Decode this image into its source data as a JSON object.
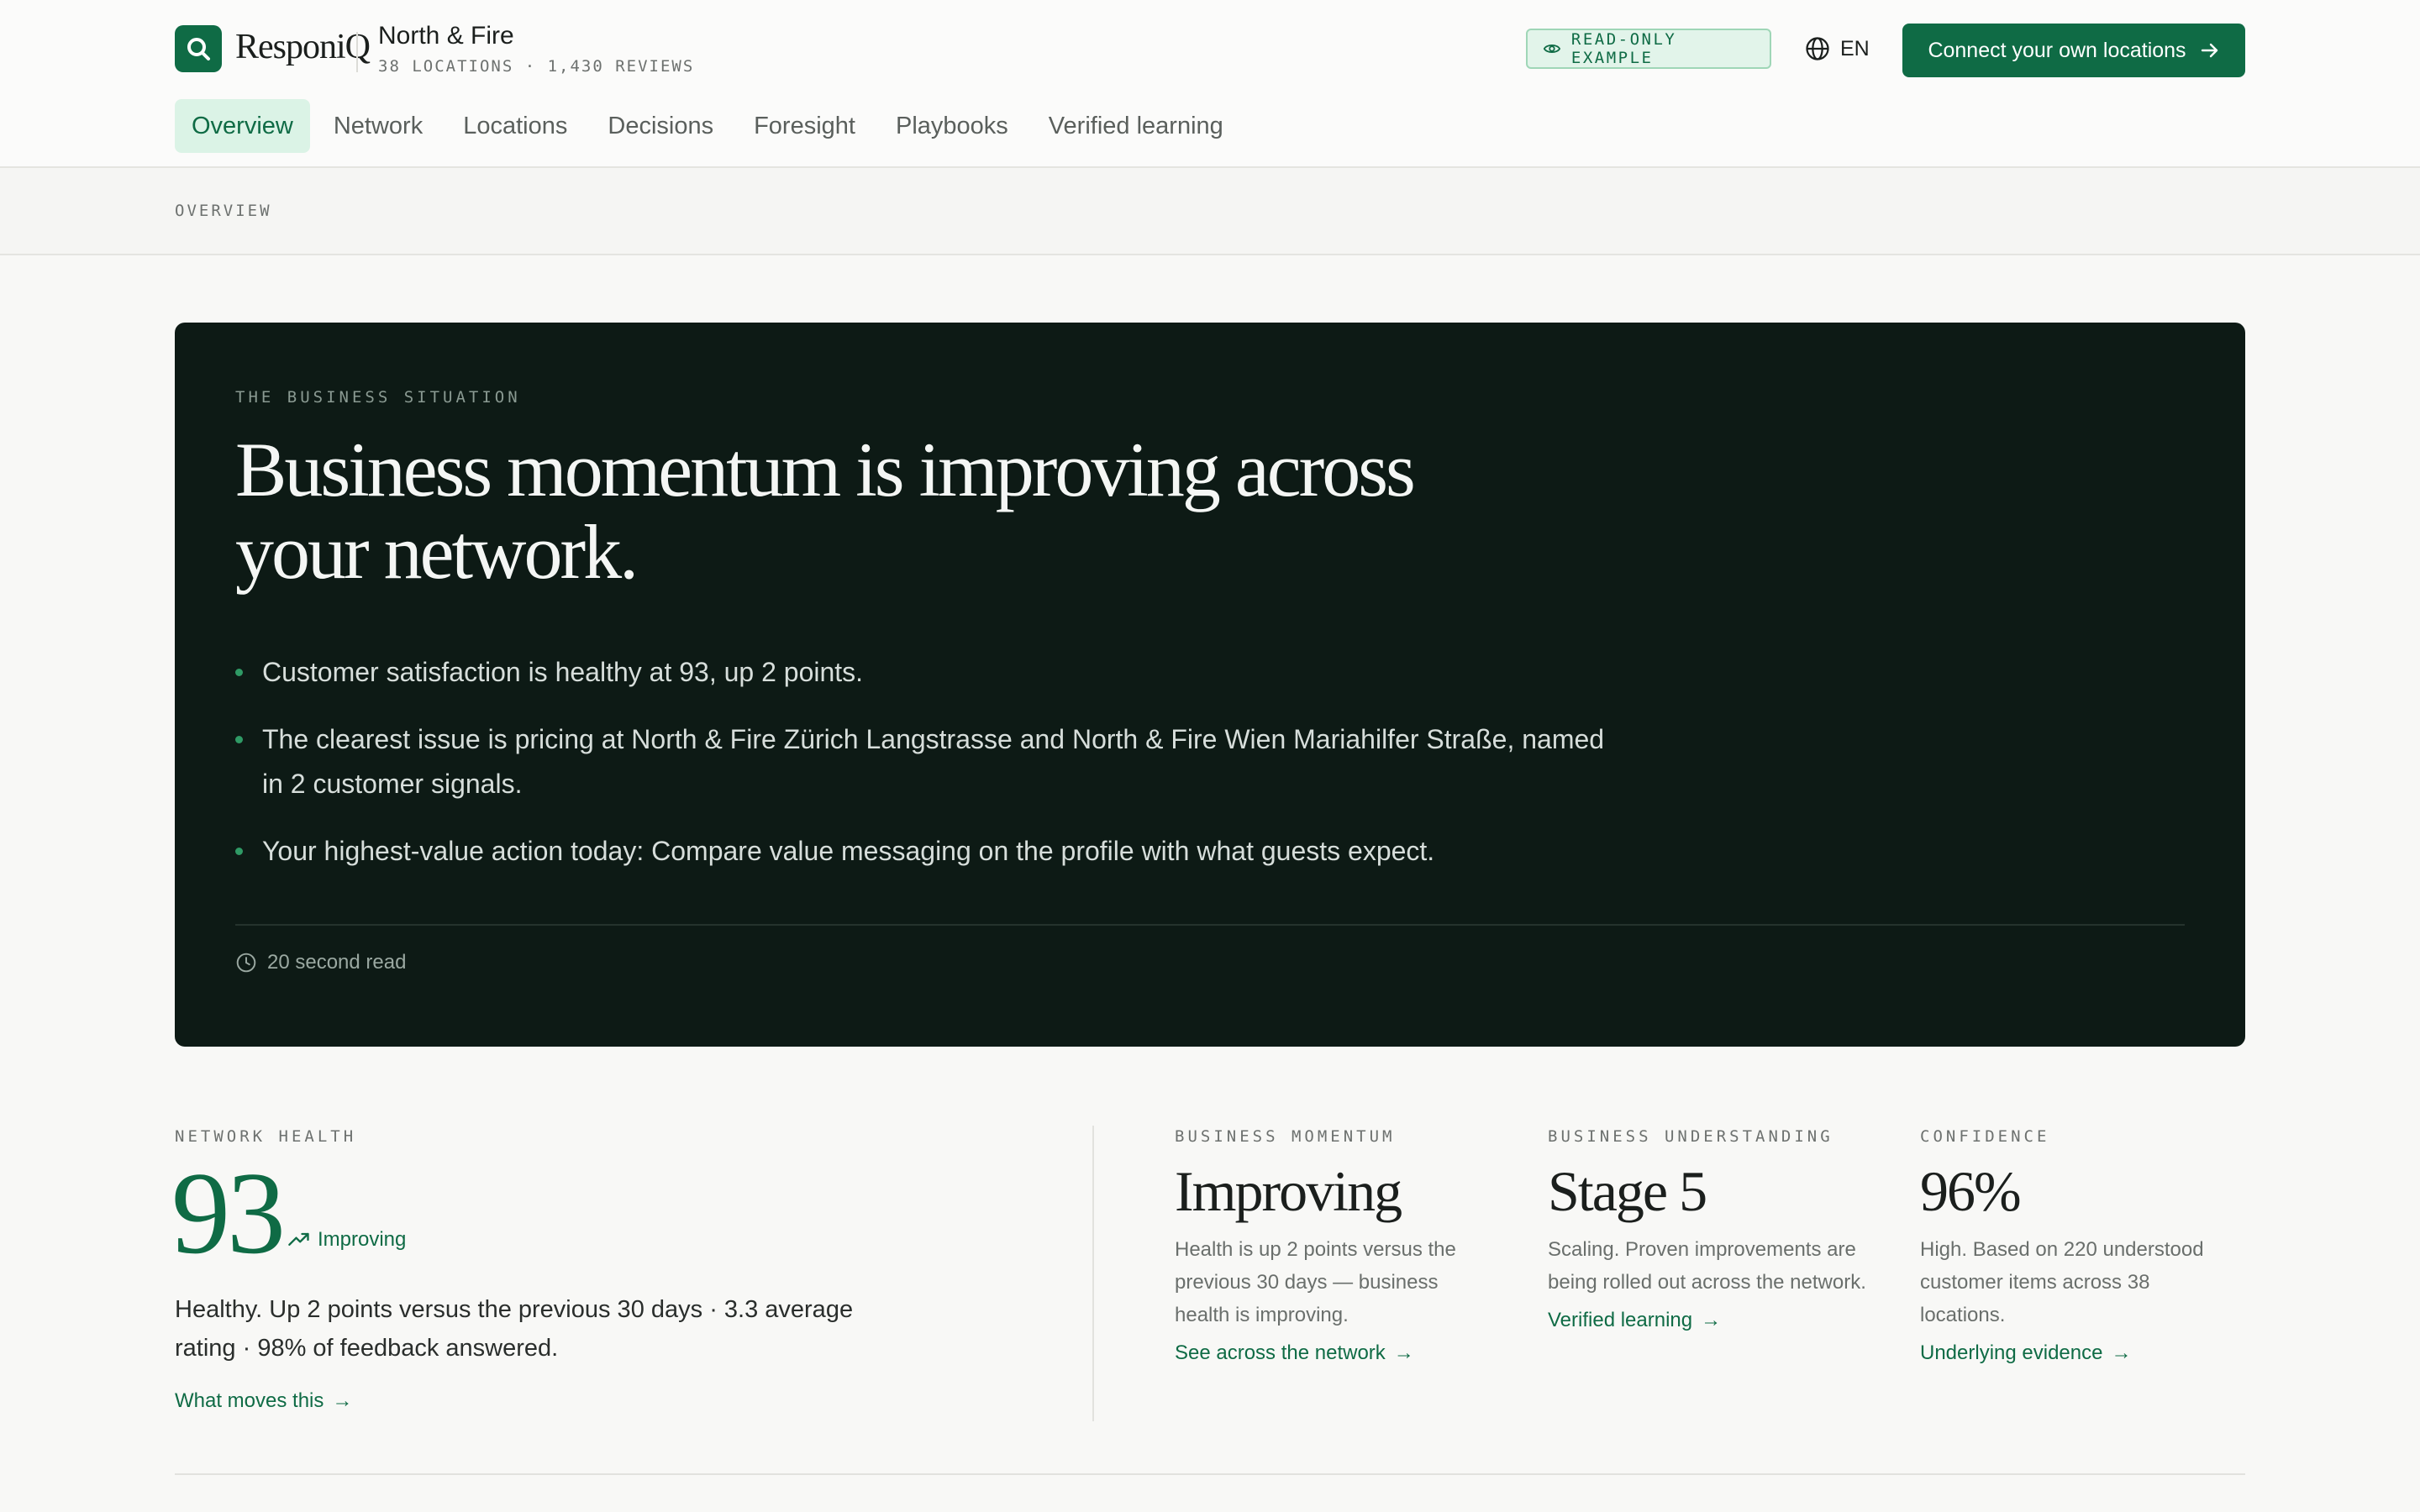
{
  "app": {
    "brand": "ResponiQ"
  },
  "header": {
    "business_name": "North & Fire",
    "business_meta": "38 LOCATIONS · 1,430 REVIEWS",
    "readonly_badge": "READ-ONLY EXAMPLE",
    "language": "EN",
    "cta_label": "Connect your own locations"
  },
  "tabs": [
    {
      "label": "Overview",
      "active": true
    },
    {
      "label": "Network"
    },
    {
      "label": "Locations"
    },
    {
      "label": "Decisions"
    },
    {
      "label": "Foresight"
    },
    {
      "label": "Playbooks"
    },
    {
      "label": "Verified learning"
    }
  ],
  "breadcrumb": "OVERVIEW",
  "hero": {
    "eyebrow": "THE BUSINESS SITUATION",
    "title": "Business momentum is improving across your network.",
    "bullets": [
      "Customer satisfaction is healthy at 93, up 2 points.",
      "The clearest issue is pricing at North & Fire Zürich Langstrasse and North & Fire Wien Mariahilfer Straße, named in 2 customer signals.",
      "Your highest-value action today: Compare value messaging on the profile with what guests expect."
    ],
    "read_time": "20 second read"
  },
  "network_health": {
    "label": "NETWORK HEALTH",
    "value": "93",
    "trend": "Improving",
    "description": "Healthy. Up 2 points versus the previous 30 days · 3.3 average rating · 98% of feedback answered.",
    "link": "What moves this"
  },
  "metrics": [
    {
      "label": "BUSINESS MOMENTUM",
      "value": "Improving",
      "description": "Health is up 2 points versus the previous 30 days — business health is improving.",
      "link": "See across the network"
    },
    {
      "label": "BUSINESS UNDERSTANDING",
      "value": "Stage 5",
      "description": "Scaling. Proven improvements are being rolled out across the network.",
      "link": "Verified learning"
    },
    {
      "label": "CONFIDENCE",
      "value": "96%",
      "description": "High. Based on 220 understood customer items across 38 locations.",
      "link": "Underlying evidence"
    }
  ],
  "colors": {
    "brand_green": "#0f6b45",
    "hero_background": "#0d1a15",
    "badge_background": "#e2f4ea"
  },
  "icons": [
    "search-icon",
    "eye-icon",
    "globe-icon",
    "arrow-right-icon",
    "clock-icon",
    "trending-up-icon"
  ]
}
